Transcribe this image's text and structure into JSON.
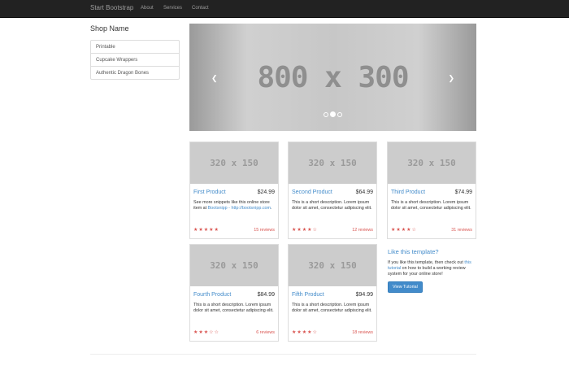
{
  "navbar": {
    "brand": "Start Bootstrap",
    "links": [
      "About",
      "Services",
      "Contact"
    ]
  },
  "sidebar": {
    "title": "Shop Name",
    "items": [
      {
        "label": "Printable"
      },
      {
        "label": "Cupcake Wrappers"
      },
      {
        "label": "Authentic Dragon Bones"
      }
    ]
  },
  "carousel": {
    "text": "800 x 300",
    "prev_icon": "chevron-left-icon",
    "next_icon": "chevron-right-icon",
    "slides": 3,
    "active_slide": 2
  },
  "products": [
    {
      "thumb": "320 x 150",
      "name": "First Product",
      "price": "$24.99",
      "desc_prefix": "See more snippets like this online store item at ",
      "link_text": "Bootsnipp - http://bootsnipp.com",
      "desc_suffix": ".",
      "rating": 5,
      "reviews": "15 reviews"
    },
    {
      "thumb": "320 x 150",
      "name": "Second Product",
      "price": "$64.99",
      "desc": "This is a short description. Lorem ipsum dolor sit amet, consectetur adipiscing elit.",
      "rating": 4,
      "reviews": "12 reviews"
    },
    {
      "thumb": "320 x 150",
      "name": "Third Product",
      "price": "$74.99",
      "desc": "This is a short description. Lorem ipsum dolor sit amet, consectetur adipiscing elit.",
      "rating": 4,
      "reviews": "31 reviews"
    },
    {
      "thumb": "320 x 150",
      "name": "Fourth Product",
      "price": "$84.99",
      "desc": "This is a short description. Lorem ipsum dolor sit amet, consectetur adipiscing elit.",
      "rating": 3,
      "reviews": "6 reviews"
    },
    {
      "thumb": "320 x 150",
      "name": "Fifth Product",
      "price": "$94.99",
      "desc": "This is a short description. Lorem ipsum dolor sit amet, consectetur adipiscing elit.",
      "rating": 4,
      "reviews": "18 reviews"
    }
  ],
  "promo": {
    "title": "Like this template?",
    "text_prefix": "If you like this template, then check out ",
    "link_text": "this tutorial",
    "text_suffix": " on how to build a working review system for your online store!",
    "button": "View Tutorial"
  },
  "colors": {
    "accent": "#428bca",
    "star": "#d9534f",
    "navbar": "#222222"
  }
}
